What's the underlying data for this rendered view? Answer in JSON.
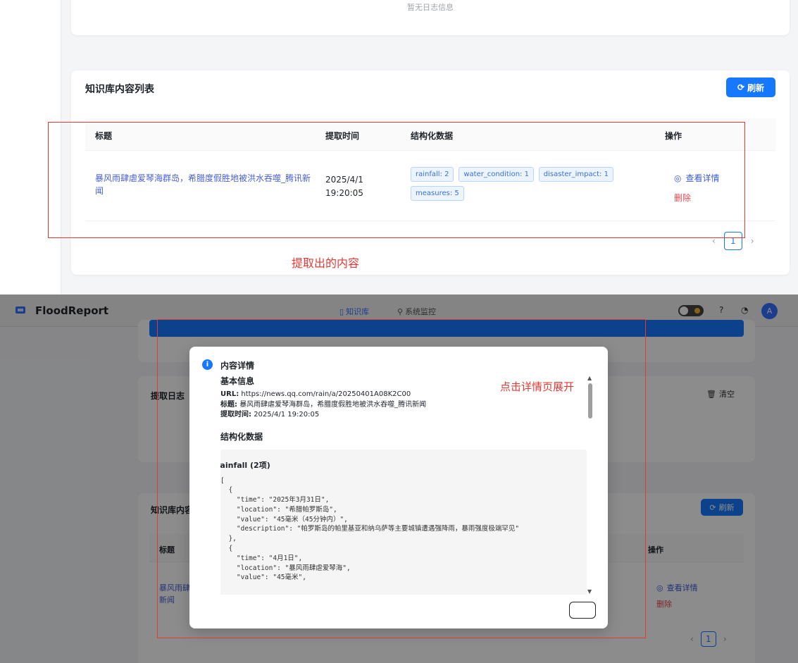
{
  "top": {
    "log_empty_text": "暂无日志信息",
    "kb_title": "知识库内容列表",
    "refresh_label": "刷新",
    "table_headers": {
      "title": "标题",
      "time": "提取时间",
      "data": "结构化数据",
      "ops": "操作"
    },
    "row": {
      "title": "暴风雨肆虐爱琴海群岛，希腊度假胜地被洪水吞噬_腾讯新闻",
      "date": "2025/4/1",
      "clock": "19:20:05",
      "tags": [
        "rainfall: 2",
        "water_condition: 1",
        "disaster_impact: 1",
        "measures: 5"
      ],
      "view_label": "查看详情",
      "delete_label": "删除"
    },
    "pager": {
      "prev": "‹",
      "page": "1",
      "next": "›"
    },
    "annotation": "提取出的内容"
  },
  "app": {
    "name": "FloodReport",
    "nav_kb": "知识库",
    "nav_monitor": "系统监控",
    "avatar_letter": "A",
    "log_title": "提取日志",
    "clear_label": "清空",
    "kb_title_partial": "知识库内容",
    "refresh_label": "刷新",
    "head_title": "标题",
    "head_ops": "操作",
    "row_title_partial_1": "暴风雨肆虐",
    "row_title_partial_2": "新闻",
    "view_label": "查看详情",
    "delete_label": "删除",
    "pager_page": "1"
  },
  "modal": {
    "title": "内容详情",
    "basic_title": "基本信息",
    "url_label": "URL:",
    "url_value": "https://news.qq.com/rain/a/20250401A08K2C00",
    "title_label": "标题:",
    "title_value": "暴风雨肆虐爱琴海群岛，希腊度假胜地被洪水吞噬_腾讯新闻",
    "time_label": "提取时间:",
    "time_value": "2025/4/1 19:20:05",
    "struct_title": "结构化数据",
    "code_head": "rainfall (2项)",
    "code_lines": [
      "[",
      "  {",
      "    \"time\": \"2025年3月31日\",",
      "    \"location\": \"希腊帕罗斯岛\",",
      "    \"value\": \"45毫米（45分钟内）\",",
      "    \"description\": \"帕罗斯岛的帕里基亚和纳乌萨等主要城镇遭遇强降雨，暴雨强度极端罕见\"",
      "  },",
      "  {",
      "    \"time\": \"4月1日\",",
      "    \"location\": \"暴风雨肆虐爱琴海\",",
      "    \"value\": \"45毫米\","
    ],
    "annotation": "点击详情页展开"
  },
  "colors": {
    "primary": "#1677ff",
    "annotation_red": "#e53935",
    "link": "#4a61d6",
    "danger": "#e5484d"
  }
}
